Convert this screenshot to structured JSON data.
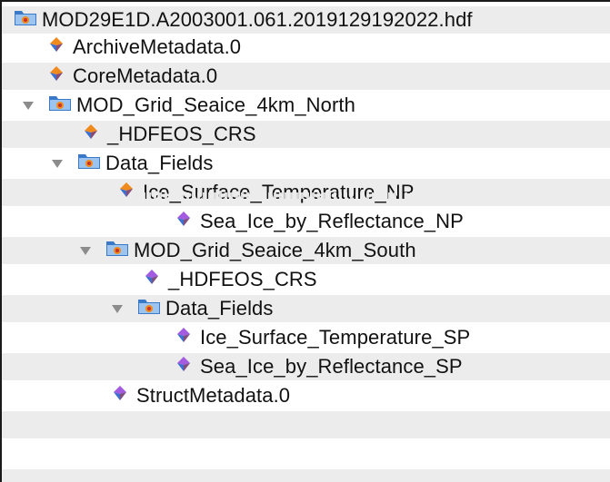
{
  "tree": {
    "rows": [
      {
        "label": "MOD29E1D.A2003001.061.2019129192022.hdf",
        "kind": "file",
        "icon": "hdf-file-icon"
      },
      {
        "label": "ArchiveMetadata.0",
        "kind": "attribute",
        "icon": "attribute-icon"
      },
      {
        "label": "CoreMetadata.0",
        "kind": "attribute",
        "icon": "attribute-icon"
      },
      {
        "label": "MOD_Grid_Seaice_4km_North",
        "kind": "group",
        "icon": "group-folder-icon",
        "expanded": true
      },
      {
        "label": "_HDFEOS_CRS",
        "kind": "attribute",
        "icon": "attribute-icon"
      },
      {
        "label": "Data_Fields",
        "kind": "group",
        "icon": "group-folder-icon",
        "expanded": true
      },
      {
        "label": "Ice_Surface_Temperature_NP",
        "kind": "dataset",
        "icon": "dataset-icon"
      },
      {
        "label": "Sea_Ice_by_Reflectance_NP",
        "kind": "dataset",
        "icon": "dataset-icon"
      },
      {
        "label": "MOD_Grid_Seaice_4km_South",
        "kind": "group",
        "icon": "group-folder-icon",
        "expanded": true
      },
      {
        "label": "_HDFEOS_CRS",
        "kind": "attribute",
        "icon": "attribute-icon"
      },
      {
        "label": "Data_Fields",
        "kind": "group",
        "icon": "group-folder-icon",
        "expanded": true
      },
      {
        "label": "Ice_Surface_Temperature_SP",
        "kind": "dataset",
        "icon": "dataset-icon"
      },
      {
        "label": "Sea_Ice_by_Reflectance_SP",
        "kind": "dataset",
        "icon": "dataset-icon"
      },
      {
        "label": "StructMetadata.0",
        "kind": "attribute",
        "icon": "attribute-icon"
      }
    ]
  },
  "colors": {
    "stripe": "#ececec",
    "folder_blue": "#3a78c8",
    "folder_light": "#9cc4ef",
    "attr_orange": "#f08a1c",
    "attr_blue": "#3b6fd0",
    "dataset_purple": "#a35be0"
  }
}
